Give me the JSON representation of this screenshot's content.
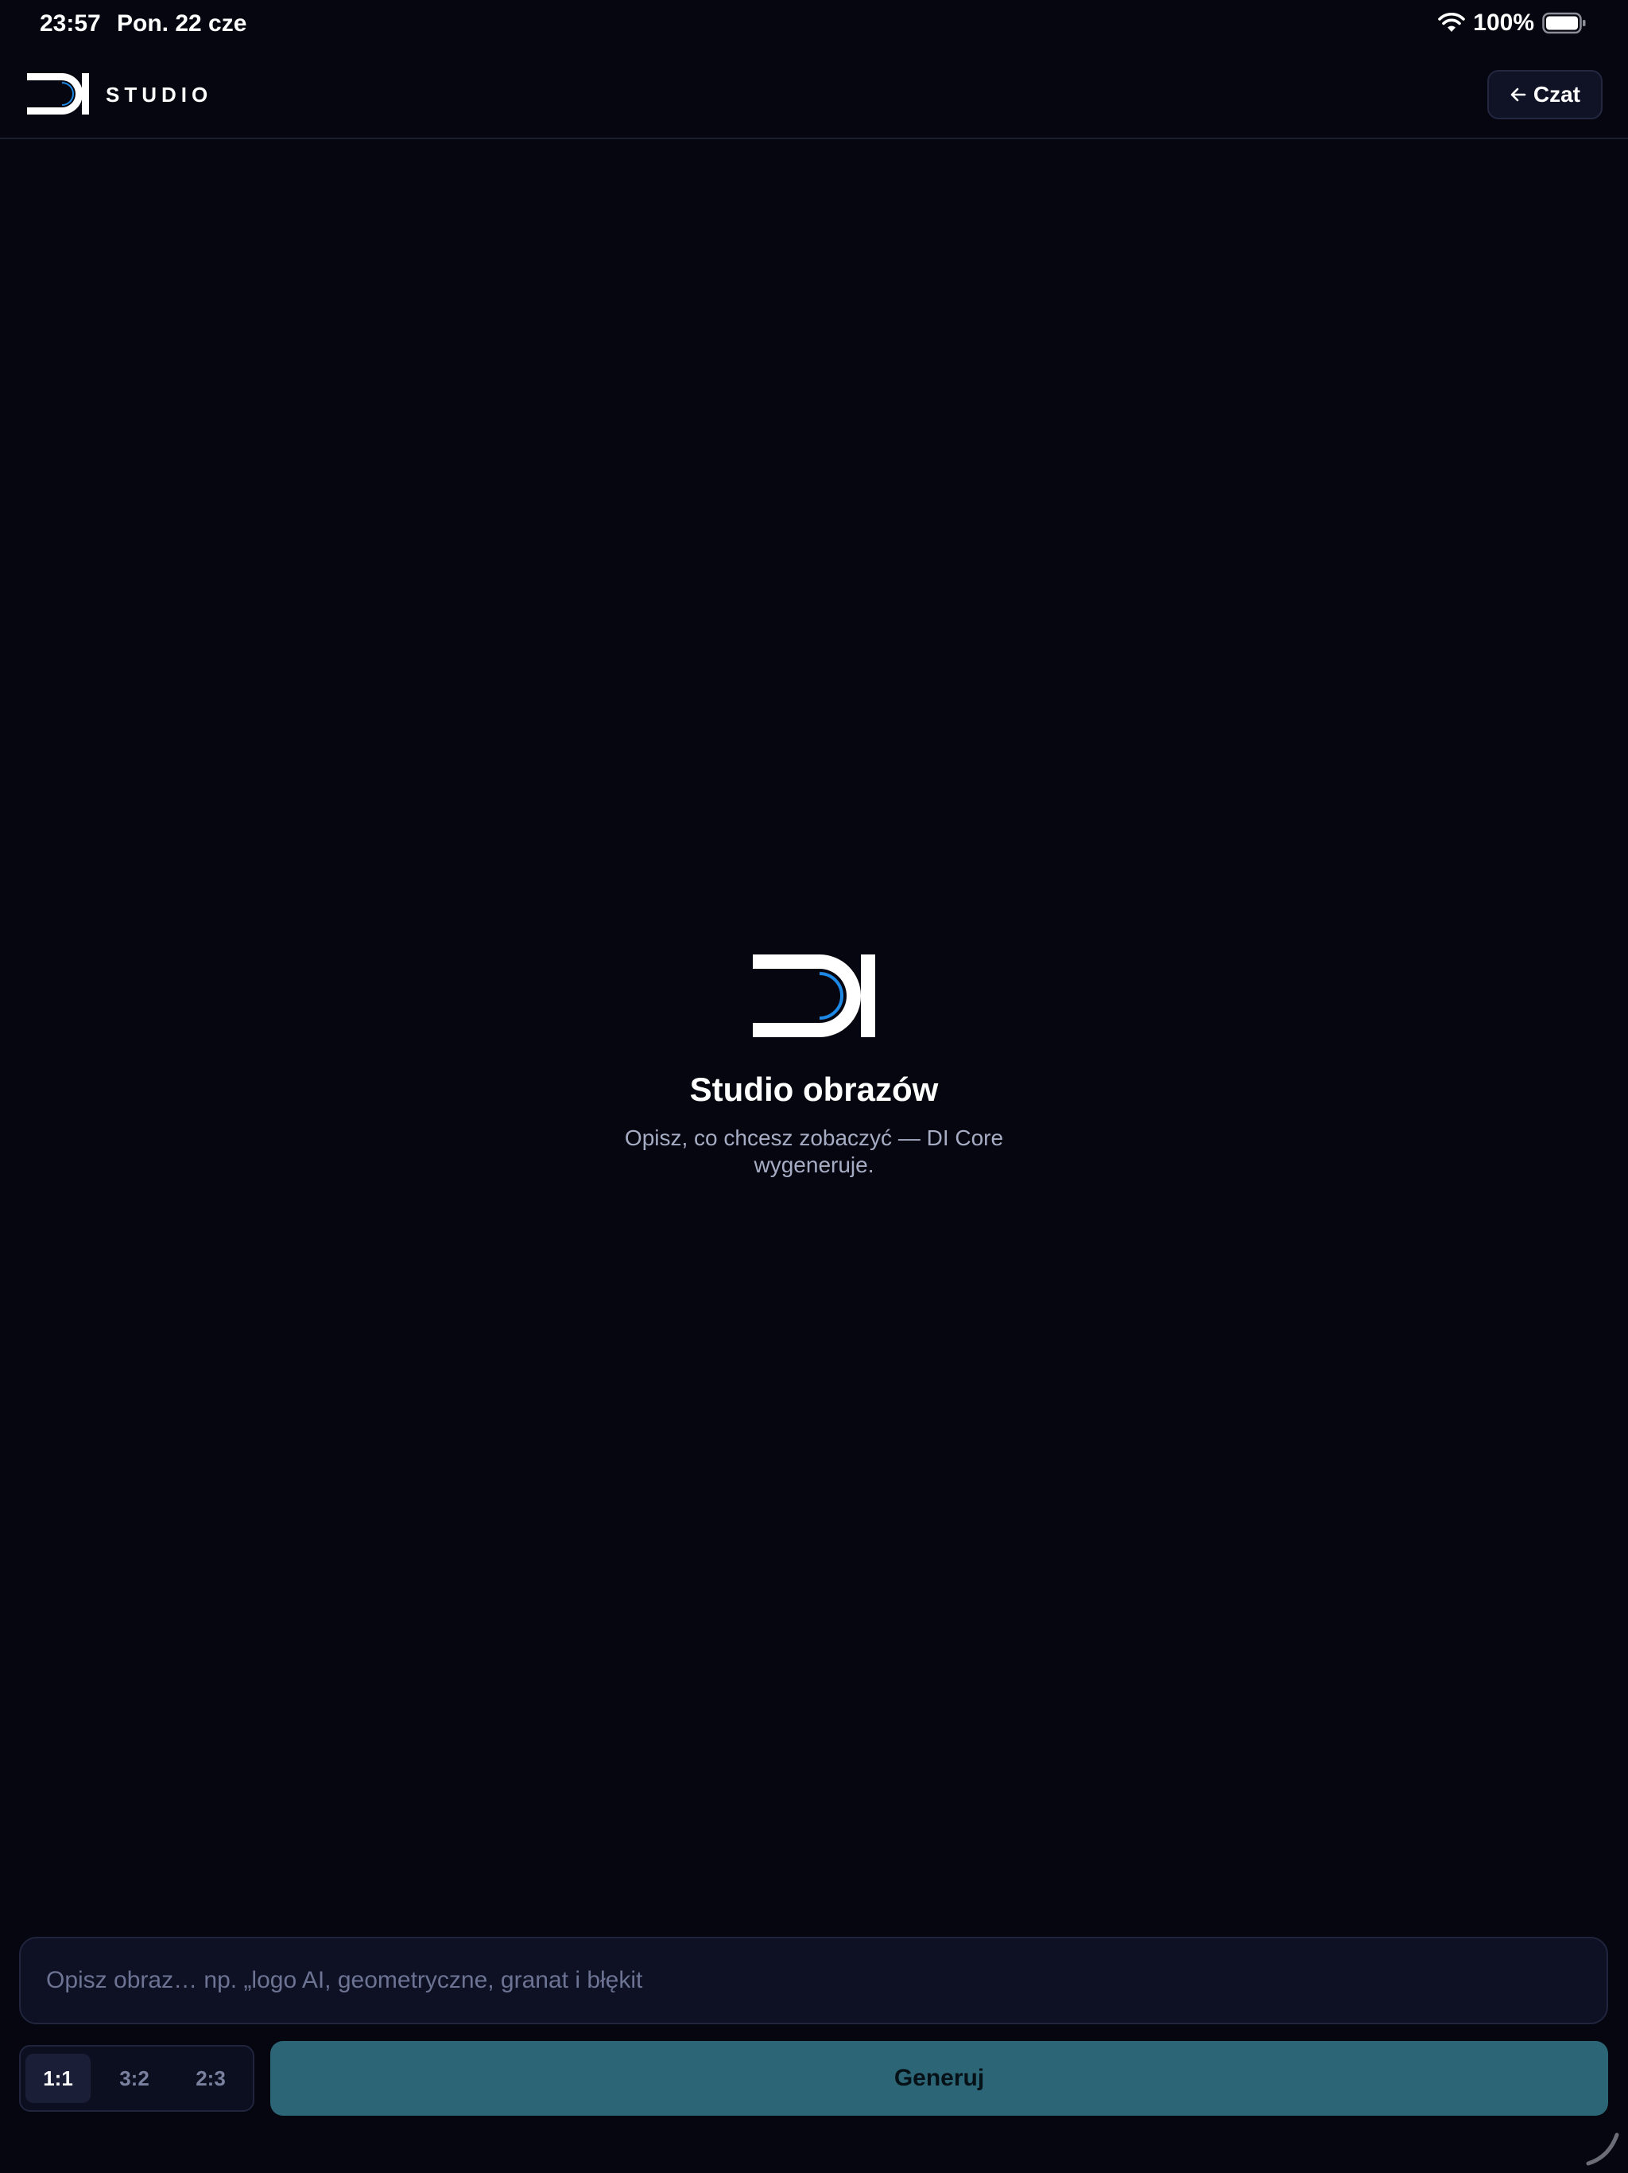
{
  "status_bar": {
    "time": "23:57",
    "date": "Pon. 22 cze",
    "battery_percent": "100%",
    "wifi_icon": "wifi-icon",
    "battery_icon": "battery-icon"
  },
  "header": {
    "logo_icon": "di-logo-icon",
    "title": "STUDIO",
    "back_button_label": "Czat",
    "back_icon": "arrow-left-icon"
  },
  "empty_state": {
    "logo_icon": "di-logo-icon",
    "title": "Studio obrazów",
    "subtitle": "Opisz, co chcesz zobaczyć — DI Core wygeneruje."
  },
  "prompt": {
    "value": "",
    "placeholder": "Opisz obraz… np. „logo AI, geometryczne, granat i błękit"
  },
  "aspect_ratios": {
    "options": [
      "1:1",
      "3:2",
      "2:3"
    ],
    "selected": "1:1"
  },
  "generate_button_label": "Generuj",
  "colors": {
    "background": "#05060f",
    "accent_button": "#2c6676",
    "logo_accent": "#1e88e5"
  }
}
